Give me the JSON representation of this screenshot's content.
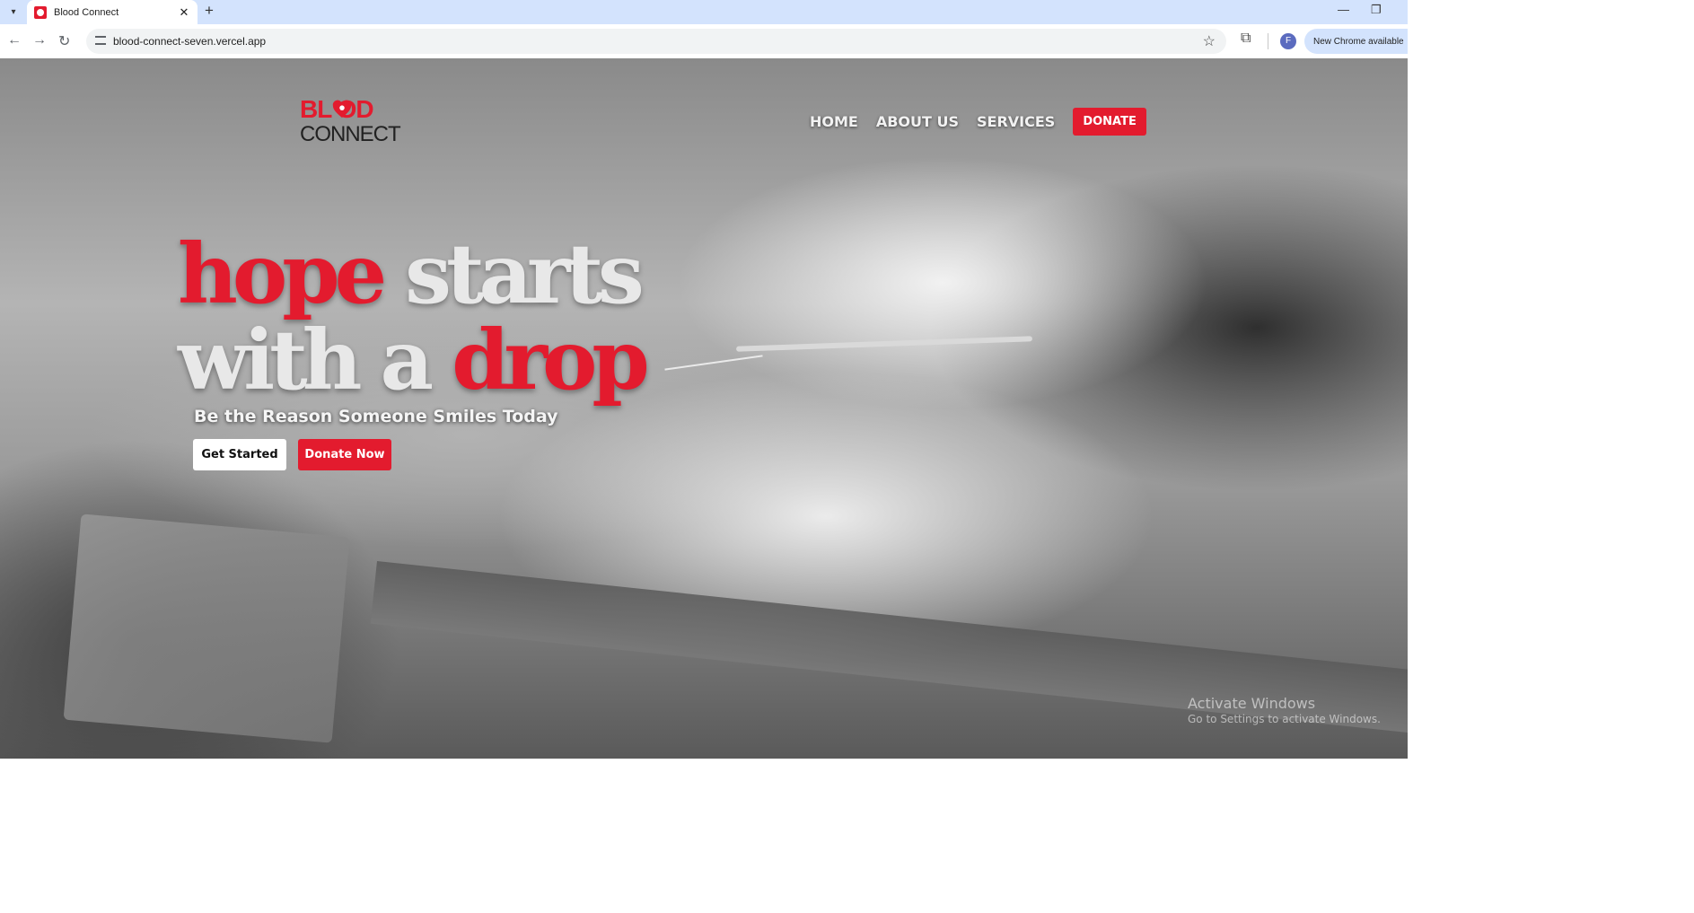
{
  "browser": {
    "tab_title": "Blood Connect",
    "tab_close": "✕",
    "new_tab": "+",
    "url": "blood-connect-seven.vercel.app",
    "new_chrome": "New Chrome available",
    "profile_initial": "F",
    "icons": [
      "tab-search-icon",
      "favicon-icon",
      "close-icon",
      "plus-icon",
      "minimize-icon",
      "restore-icon",
      "back-icon",
      "forward-icon",
      "reload-icon",
      "site-info-icon",
      "star-icon",
      "extensions-icon"
    ]
  },
  "site": {
    "logo_top": "BL  OD",
    "logo_bottom": "CONNECT",
    "nav": {
      "home": "HOME",
      "about": "ABOUT US",
      "services": "SERVICES",
      "donate": "DONATE"
    },
    "hero": {
      "word1": "hope",
      "word2": "starts",
      "word3": "with a",
      "word4": "drop",
      "tagline": "Be the Reason Someone Smiles Today",
      "btn_start": "Get Started",
      "btn_donate": "Donate Now"
    }
  },
  "watermark": {
    "title": "Activate Windows",
    "subtitle": "Go to Settings to activate Windows."
  },
  "colors": {
    "brand_red": "#e31b2e",
    "tabbar": "#d3e3fd"
  }
}
